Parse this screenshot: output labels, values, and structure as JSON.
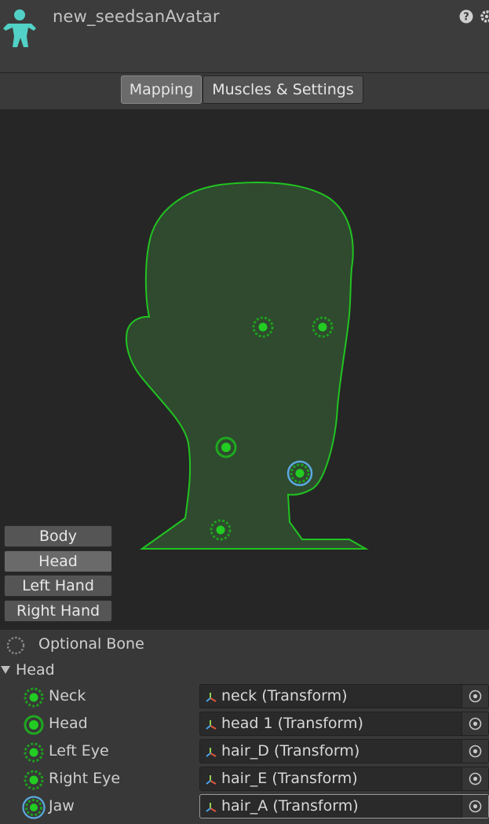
{
  "header": {
    "title": "new_seedsanAvatar",
    "avatar_icon": "humanoid-avatar-icon",
    "help_icon": "help-icon",
    "settings_icon": "gear-icon"
  },
  "tabs": [
    {
      "label": "Mapping",
      "active": true
    },
    {
      "label": "Muscles & Settings",
      "active": false
    }
  ],
  "body_parts": [
    {
      "label": "Body",
      "active": false
    },
    {
      "label": "Head",
      "active": true
    },
    {
      "label": "Left Hand",
      "active": false
    },
    {
      "label": "Right Hand",
      "active": false
    }
  ],
  "legend": {
    "label": "Optional Bone"
  },
  "section": {
    "label": "Head",
    "expanded": true
  },
  "bones": [
    {
      "label": "Neck",
      "value": "neck (Transform)",
      "optional": true,
      "selected": false
    },
    {
      "label": "Head",
      "value": "head 1 (Transform)",
      "optional": false,
      "selected": false
    },
    {
      "label": "Left Eye",
      "value": "hair_D (Transform)",
      "optional": true,
      "selected": false
    },
    {
      "label": "Right Eye",
      "value": "hair_E (Transform)",
      "optional": true,
      "selected": false
    },
    {
      "label": "Jaw",
      "value": "hair_A (Transform)",
      "optional": true,
      "selected": true
    }
  ],
  "colors": {
    "mapped_green": "#21c321",
    "head_fill": "#2f4a2f",
    "selection_blue": "#5aa9e0",
    "avatar_cyan": "#52d1c6"
  }
}
